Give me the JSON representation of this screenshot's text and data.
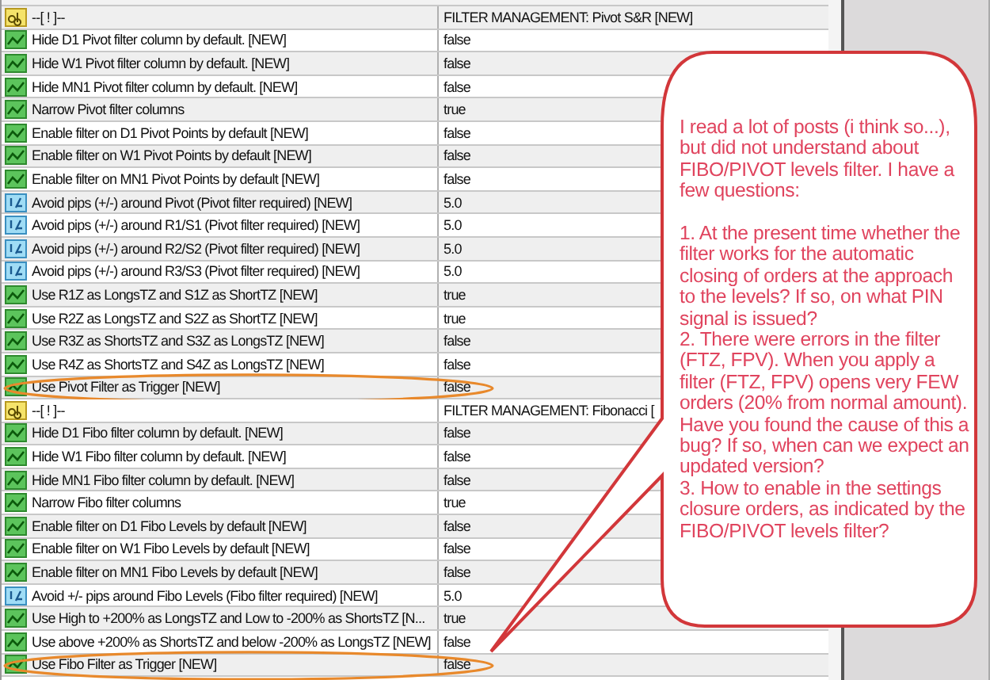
{
  "table": {
    "rows": [
      {
        "kind": "string",
        "name": "--[ ! ]--",
        "value": "FILTER MANAGEMENT: Pivot S&R [NEW]",
        "highlighted": false
      },
      {
        "kind": "bool",
        "name": "Hide D1 Pivot filter column by default. [NEW]",
        "value": "false",
        "highlighted": false
      },
      {
        "kind": "bool",
        "name": "Hide W1 Pivot filter column by default. [NEW]",
        "value": "false",
        "highlighted": false
      },
      {
        "kind": "bool",
        "name": "Hide MN1 Pivot filter column by default. [NEW]",
        "value": "false",
        "highlighted": false
      },
      {
        "kind": "bool",
        "name": "Narrow Pivot filter columns",
        "value": "true",
        "highlighted": false
      },
      {
        "kind": "bool",
        "name": "Enable filter on D1 Pivot Points by default [NEW]",
        "value": "false",
        "highlighted": false
      },
      {
        "kind": "bool",
        "name": "Enable filter on W1 Pivot Points by default [NEW]",
        "value": "false",
        "highlighted": false
      },
      {
        "kind": "bool",
        "name": "Enable filter on MN1 Pivot Points by default [NEW]",
        "value": "false",
        "highlighted": false
      },
      {
        "kind": "double",
        "name": "Avoid pips (+/-) around Pivot (Pivot filter required) [NEW]",
        "value": "5.0",
        "highlighted": false
      },
      {
        "kind": "double",
        "name": "Avoid pips (+/-) around R1/S1 (Pivot filter required) [NEW]",
        "value": "5.0",
        "highlighted": false
      },
      {
        "kind": "double",
        "name": "Avoid pips (+/-) around R2/S2 (Pivot filter required) [NEW]",
        "value": "5.0",
        "highlighted": false
      },
      {
        "kind": "double",
        "name": "Avoid pips (+/-) around R3/S3 (Pivot filter required) [NEW]",
        "value": "5.0",
        "highlighted": false
      },
      {
        "kind": "bool",
        "name": "Use R1Z as LongsTZ and S1Z as ShortTZ [NEW]",
        "value": "true",
        "highlighted": false
      },
      {
        "kind": "bool",
        "name": "Use R2Z as LongsTZ and S2Z as ShortTZ [NEW]",
        "value": "true",
        "highlighted": false
      },
      {
        "kind": "bool",
        "name": "Use R3Z as ShortsTZ and S3Z as LongsTZ [NEW]",
        "value": "false",
        "highlighted": false
      },
      {
        "kind": "bool",
        "name": "Use R4Z as ShortsTZ and S4Z as LongsTZ [NEW]",
        "value": "false",
        "highlighted": false
      },
      {
        "kind": "bool",
        "name": "Use Pivot Filter as Trigger [NEW]",
        "value": "false",
        "highlighted": true
      },
      {
        "kind": "string",
        "name": "--[ ! ]--",
        "value": "FILTER MANAGEMENT: Fibonacci [",
        "highlighted": false
      },
      {
        "kind": "bool",
        "name": "Hide D1 Fibo filter column by default. [NEW]",
        "value": "false",
        "highlighted": false
      },
      {
        "kind": "bool",
        "name": "Hide W1 Fibo filter column by default. [NEW]",
        "value": "false",
        "highlighted": false
      },
      {
        "kind": "bool",
        "name": "Hide MN1 Fibo filter column by default. [NEW]",
        "value": "false",
        "highlighted": false
      },
      {
        "kind": "bool",
        "name": "Narrow Fibo filter columns",
        "value": "true",
        "highlighted": false
      },
      {
        "kind": "bool",
        "name": "Enable filter on D1 Fibo Levels by default [NEW]",
        "value": "false",
        "highlighted": false
      },
      {
        "kind": "bool",
        "name": "Enable filter on W1 Fibo Levels by default [NEW]",
        "value": "false",
        "highlighted": false
      },
      {
        "kind": "bool",
        "name": "Enable filter on MN1 Fibo Levels by default [NEW]",
        "value": "false",
        "highlighted": false
      },
      {
        "kind": "double",
        "name": "Avoid +/- pips around Fibo Levels (Fibo filter required) [NEW]",
        "value": "5.0",
        "highlighted": false
      },
      {
        "kind": "bool",
        "name": "Use High to +200% as LongsTZ and Low to -200% as ShortsTZ [N...",
        "value": "true",
        "highlighted": false
      },
      {
        "kind": "bool",
        "name": "Use above +200% as ShortsTZ and below -200% as LongsTZ [NEW]",
        "value": "false",
        "highlighted": false
      },
      {
        "kind": "bool",
        "name": "Use Fibo Filter as Trigger [NEW]",
        "value": "false",
        "highlighted": true
      }
    ]
  },
  "callout": {
    "paragraphs": [
      "I read a lot of posts (i think so...), but did not understand about FIBO/PIVOT levels filter. I have a few questions:",
      "1. At the present time whether the filter works for the automatic closing of orders at the approach to the levels? If so, on what PIN signal is issued?",
      "2. There were errors in the filter (FTZ, FPV). When you apply a filter (FTZ, FPV) opens very FEW orders (20% from  normal amount). Have you found the cause of this a bug? If so, when can we expect an updated version?",
      "3. How to enable in the settings closure orders, as indicated by the FIBO/PIVOT levels filter?"
    ]
  }
}
